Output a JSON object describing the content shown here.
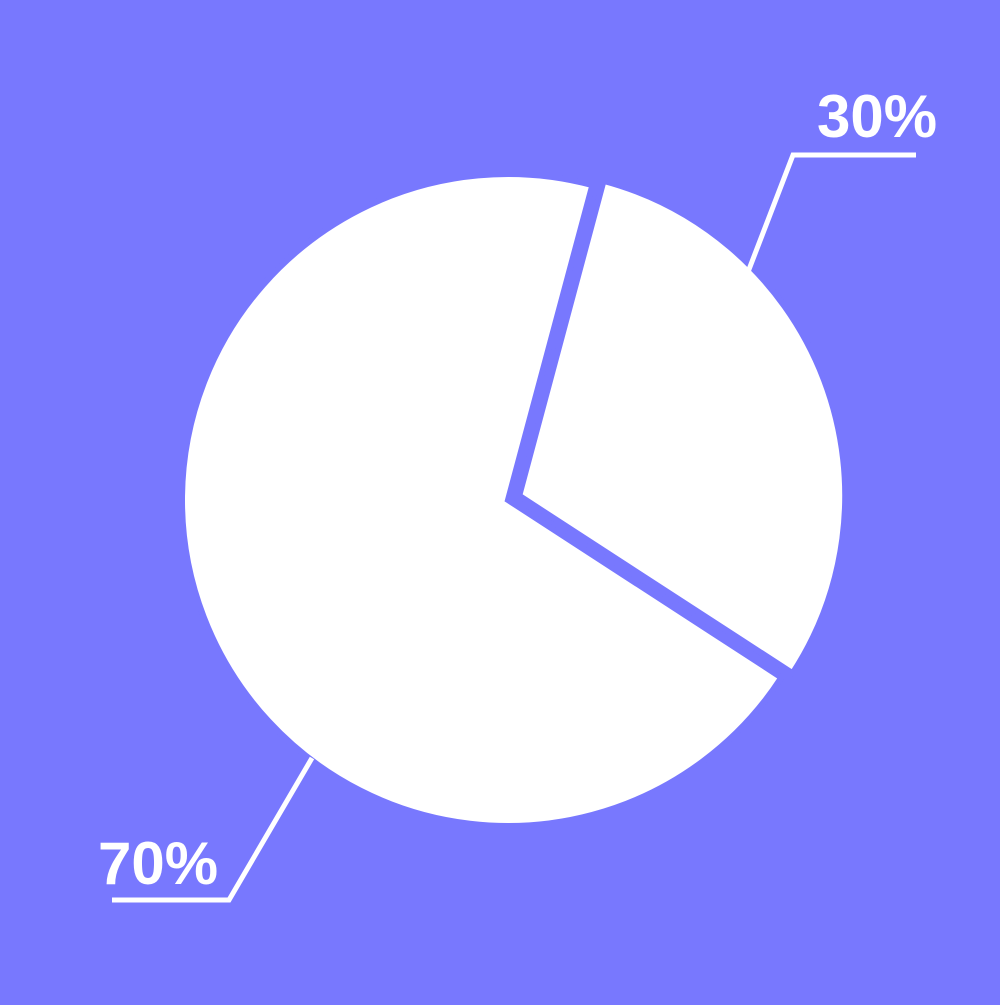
{
  "colors": {
    "background": "#7878fe",
    "slice_fill": "#ffffff",
    "leader_line": "#ffffff",
    "label_text": "#ffffff"
  },
  "chart_data": {
    "type": "pie",
    "title": "",
    "slices": [
      {
        "label": "30%",
        "value": 30
      },
      {
        "label": "70%",
        "value": 70
      }
    ],
    "legend": "none",
    "grid": false
  }
}
